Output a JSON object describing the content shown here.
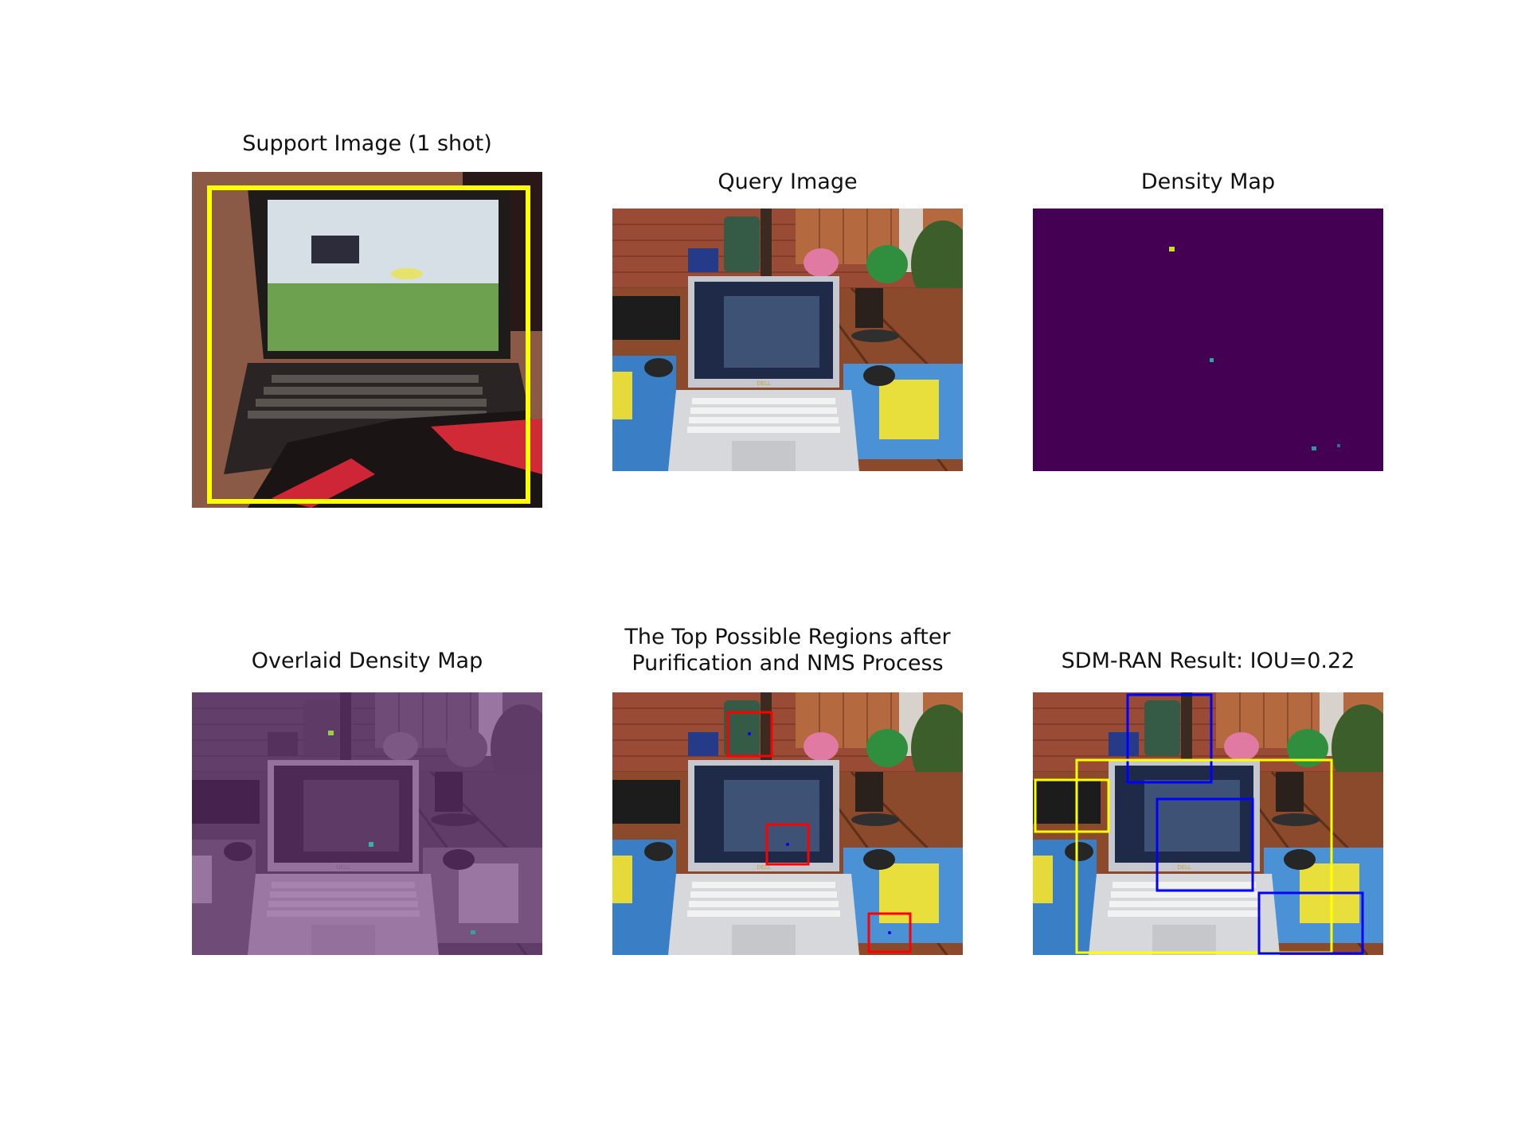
{
  "panels": {
    "support": {
      "title": "Support Image (1 shot)"
    },
    "query": {
      "title": "Query Image"
    },
    "density": {
      "title": "Density Map"
    },
    "overlaid": {
      "title": "Overlaid Density Map"
    },
    "top_regions": {
      "title": "The Top Possible Regions after\nPurification and NMS Process"
    },
    "result": {
      "title": "SDM-RAN Result: IOU=0.22"
    }
  },
  "colors": {
    "support_box": "#ffff00",
    "density_background": "#440154",
    "region_box": "#ff0000",
    "result_box_yellow": "#ffff00",
    "result_box_blue": "#0000ff"
  },
  "scene_labels": {
    "laptop_brand": "DELL"
  }
}
